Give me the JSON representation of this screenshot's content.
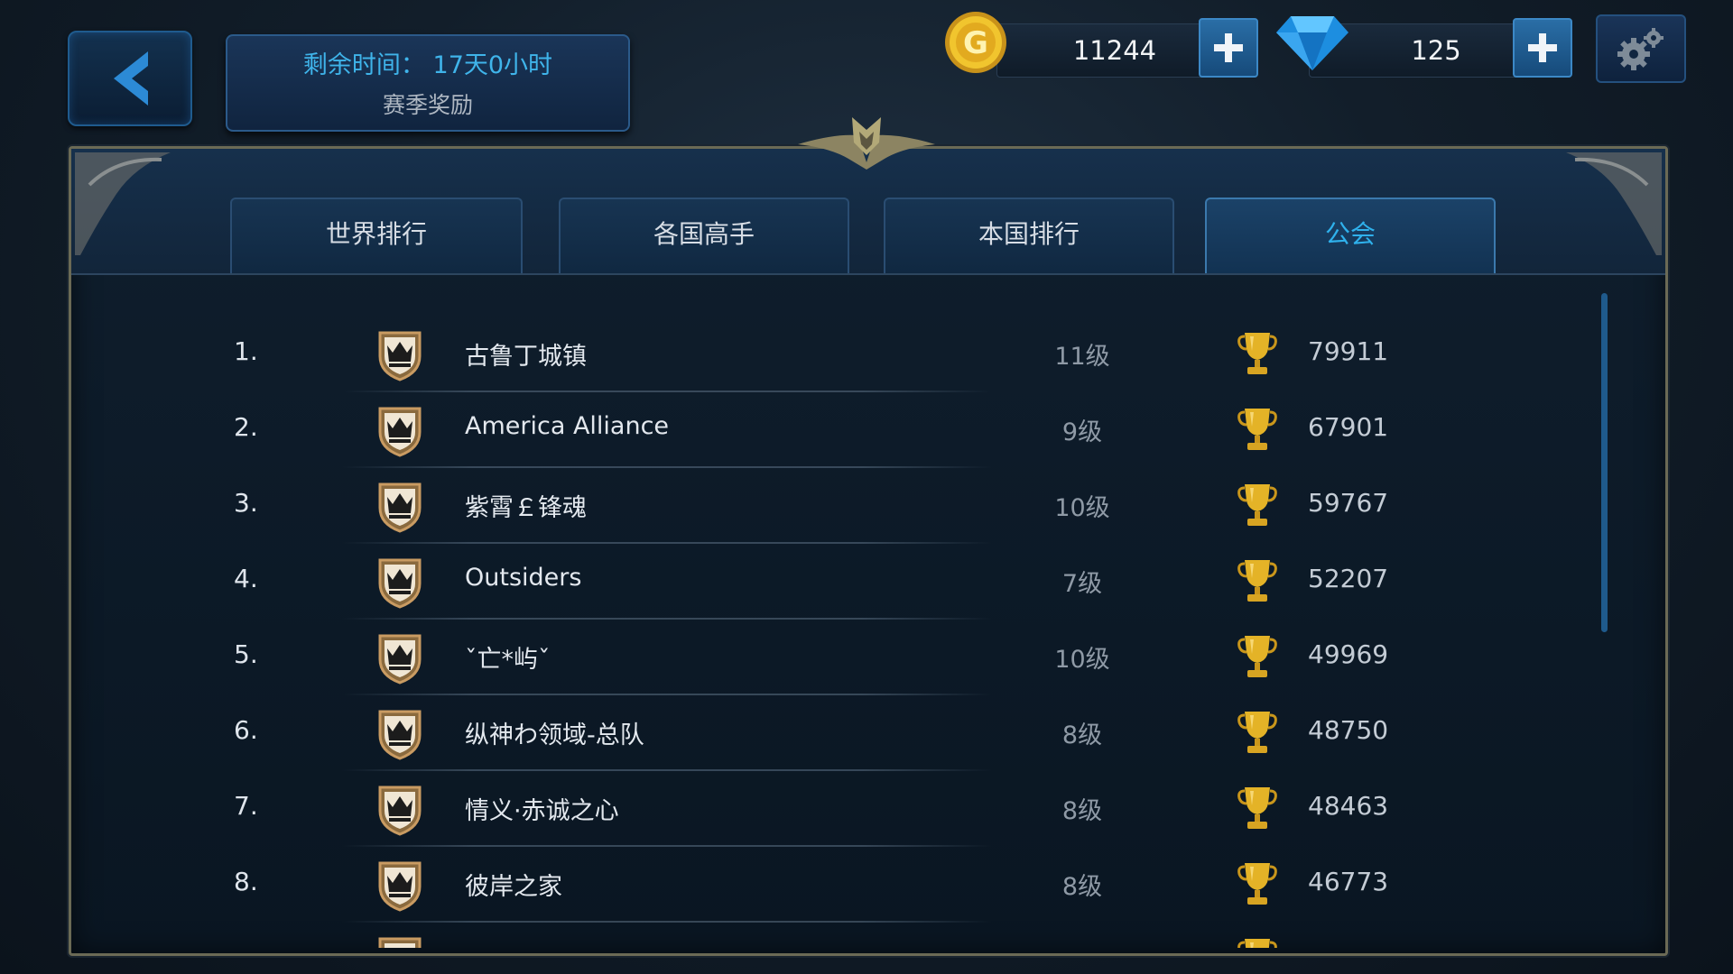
{
  "season": {
    "remaining_label": "剩余时间：",
    "remaining_value": "17天0小时",
    "reward_label": "赛季奖励"
  },
  "currency": {
    "gold": "11244",
    "diamond": "125"
  },
  "tabs": [
    {
      "label": "世界排行",
      "active": false
    },
    {
      "label": "各国高手",
      "active": false
    },
    {
      "label": "本国排行",
      "active": false
    },
    {
      "label": "公会",
      "active": true
    }
  ],
  "rows": [
    {
      "rank": "1.",
      "name": "古鲁丁城镇",
      "level": "11级",
      "score": "79911"
    },
    {
      "rank": "2.",
      "name": "America Alliance",
      "level": "9级",
      "score": "67901"
    },
    {
      "rank": "3.",
      "name": "紫霄￡锋魂",
      "level": "10级",
      "score": "59767"
    },
    {
      "rank": "4.",
      "name": "Outsiders",
      "level": "7级",
      "score": "52207"
    },
    {
      "rank": "5.",
      "name": "ˇ亡*屿ˇ",
      "level": "10级",
      "score": "49969"
    },
    {
      "rank": "6.",
      "name": "纵神わ领域-总队",
      "level": "8级",
      "score": "48750"
    },
    {
      "rank": "7.",
      "name": "情义·赤诚之心",
      "level": "8级",
      "score": "48463"
    },
    {
      "rank": "8.",
      "name": "彼岸之家",
      "level": "8级",
      "score": "46773"
    }
  ],
  "colors": {
    "accent": "#2fb1ec",
    "gold": "#e4b327",
    "panel": "#0f1e2d"
  }
}
